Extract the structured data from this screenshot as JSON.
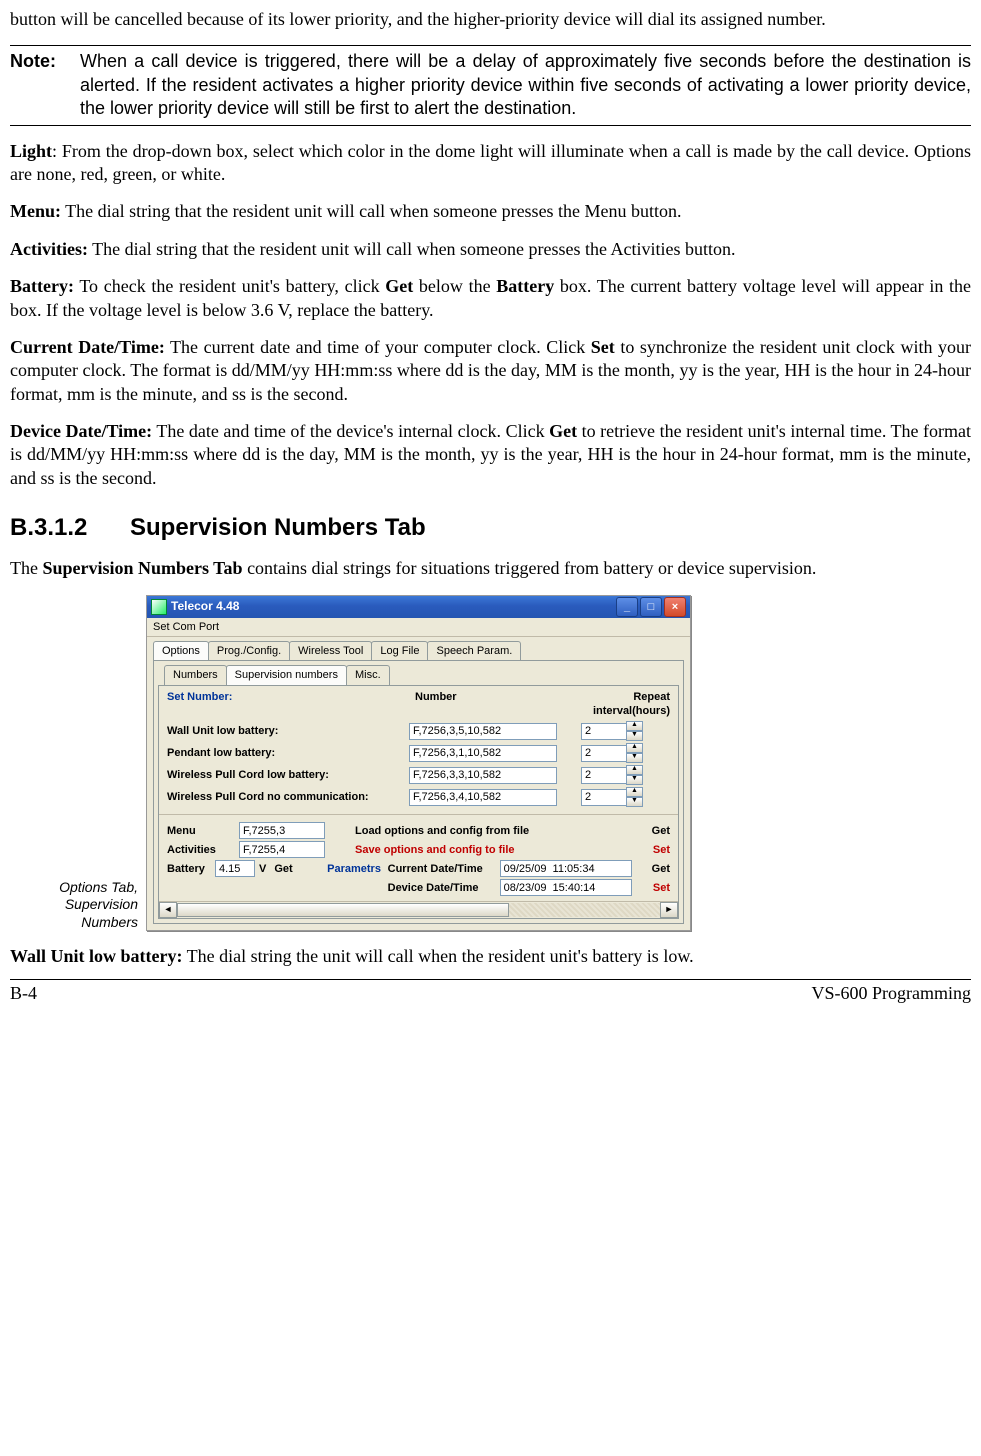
{
  "intro_tail": "button will be cancelled because of its lower priority, and the higher-priority device will dial its assigned number.",
  "note": {
    "label": "Note:",
    "body": "When a call device is triggered, there will be a delay of approximately five seconds before the destination is alerted. If the resident activates a higher priority device within five seconds of activating a lower priority device, the lower priority device will still be first to alert the destination."
  },
  "light": {
    "label": "Light",
    "body": ": From the drop-down box, select which color in the dome light will illuminate when a call is made by the call device. Options are none, red, green, or white."
  },
  "menu_p": {
    "label": "Menu:",
    "body": " The dial string that the resident unit will call when someone presses the Menu button."
  },
  "activities_p": {
    "label": "Activities:",
    "body": " The dial string that the resident unit will call when someone presses the Activities button."
  },
  "battery_p": {
    "label": "Battery:",
    "pre": " To check the resident unit's battery, click ",
    "get": "Get",
    "mid": " below the ",
    "bat2": "Battery",
    "post": " box.  The current battery voltage level will appear in the box.  If the voltage level is below 3.6 V, replace the battery."
  },
  "cdt": {
    "label": "Current Date/Time:",
    "pre": " The current date and time of your computer clock.  Click ",
    "set": "Set",
    "post": " to synchronize the resident unit clock with your computer clock.  The format is dd/MM/yy HH:mm:ss where dd is the day, MM is the month, yy is the year, HH is the hour in 24-hour format, mm is the minute, and ss is the second."
  },
  "ddt": {
    "label": "Device Date/Time:",
    "pre": " The date and time of the device's internal clock. Click ",
    "get": "Get",
    "post": " to retrieve the resident unit's internal time.  The format is dd/MM/yy HH:mm:ss where dd is the day, MM is the month, yy is the year, HH is the hour in 24-hour format, mm is the minute, and ss is the second."
  },
  "section": {
    "num": "B.3.1.2",
    "title": "Supervision Numbers Tab"
  },
  "section_intro": {
    "pre": "The ",
    "bold": "Supervision Numbers Tab",
    "post": " contains dial strings for situations triggered from battery or device supervision."
  },
  "fig_caption": "Options Tab, Supervision Numbers",
  "app": {
    "title": "Telecor 4.48",
    "menu": "Set Com Port",
    "tabs1": [
      "Options",
      "Prog./Config.",
      "Wireless Tool",
      "Log File",
      "Speech Param."
    ],
    "tabs2": [
      "Numbers",
      "Supervision numbers",
      "Misc."
    ],
    "headers": {
      "set": "Set Number:",
      "number": "Number",
      "repeat": "Repeat interval(hours)"
    },
    "rows": [
      {
        "label": "Wall Unit low battery:",
        "number": "F,7256,3,5,10,582",
        "repeat": "2"
      },
      {
        "label": "Pendant low battery:",
        "number": "F,7256,3,1,10,582",
        "repeat": "2"
      },
      {
        "label": "Wireless Pull Cord low battery:",
        "number": "F,7256,3,3,10,582",
        "repeat": "2"
      },
      {
        "label": "Wireless Pull Cord no communication:",
        "number": "F,7256,3,4,10,582",
        "repeat": "2"
      }
    ],
    "menu_row": {
      "label": "Menu",
      "value": "F,7255,3"
    },
    "activities_row": {
      "label": "Activities",
      "value": "F,7255,4"
    },
    "load_label": "Load  options and config from file",
    "save_label": "Save options and config to file",
    "get": "Get",
    "set": "Set",
    "parametrs": "Parametrs",
    "battery": {
      "label": "Battery",
      "value": "4.15",
      "v": "V",
      "get": "Get"
    },
    "current_dt": {
      "label": "Current Date/Time",
      "value": "09/25/09  11:05:34"
    },
    "device_dt": {
      "label": "Device Date/Time",
      "value": "08/23/09  15:40:14"
    }
  },
  "wall_low": {
    "label": "Wall Unit low battery:",
    "body": " The dial string the unit will call when the resident unit's battery is low."
  },
  "footer": {
    "left": "B-4",
    "right": "VS-600 Programming"
  }
}
